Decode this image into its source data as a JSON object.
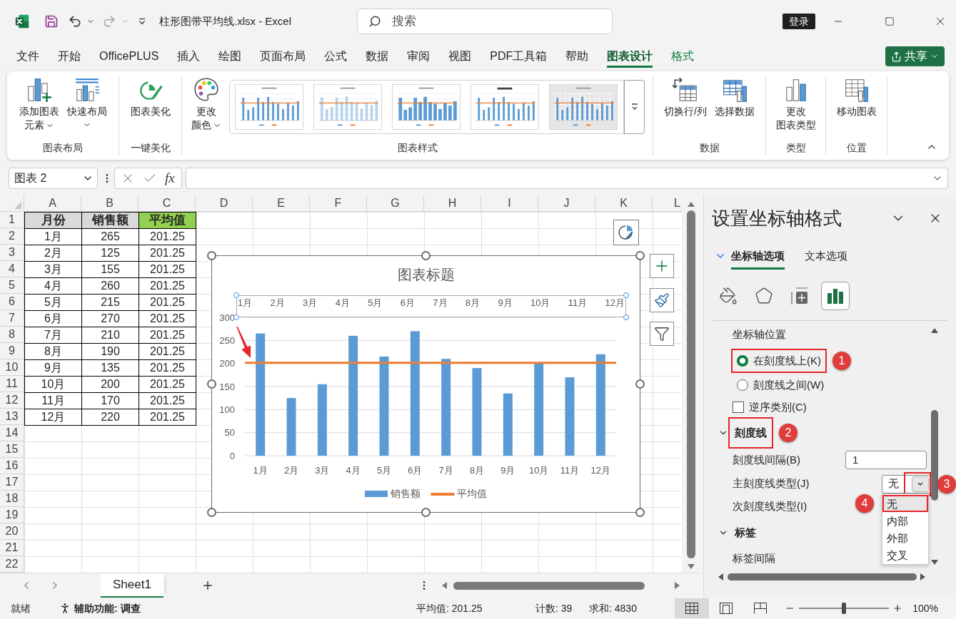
{
  "title_bar": {
    "file_title": "柱形图带平均线.xlsx - Excel",
    "search": {
      "placeholder": "搜索"
    },
    "sign_in": "登录"
  },
  "ribbon_tabs": [
    {
      "label": "文件",
      "selected": false,
      "contextual": false
    },
    {
      "label": "开始",
      "selected": false,
      "contextual": false
    },
    {
      "label": "OfficePLUS",
      "selected": false,
      "contextual": false
    },
    {
      "label": "插入",
      "selected": false,
      "contextual": false
    },
    {
      "label": "绘图",
      "selected": false,
      "contextual": false
    },
    {
      "label": "页面布局",
      "selected": false,
      "contextual": false
    },
    {
      "label": "公式",
      "selected": false,
      "contextual": false
    },
    {
      "label": "数据",
      "selected": false,
      "contextual": false
    },
    {
      "label": "审阅",
      "selected": false,
      "contextual": false
    },
    {
      "label": "视图",
      "selected": false,
      "contextual": false
    },
    {
      "label": "PDF工具箱",
      "selected": false,
      "contextual": false
    },
    {
      "label": "帮助",
      "selected": false,
      "contextual": false
    },
    {
      "label": "图表设计",
      "selected": true,
      "contextual": true
    },
    {
      "label": "格式",
      "selected": false,
      "contextual": true
    }
  ],
  "share_button": {
    "label": "共享"
  },
  "ribbon": {
    "groups": [
      {
        "label": "图表布局",
        "buttons": [
          {
            "lines": [
              "添加图表",
              "元素"
            ],
            "dropdown": true
          },
          {
            "lines": [
              "快速布局"
            ],
            "dropdown": true
          }
        ]
      },
      {
        "label": "一键美化",
        "buttons": [
          {
            "lines": [
              "图表美化"
            ],
            "dropdown": false
          }
        ]
      },
      {
        "label": "图表样式",
        "buttons": [
          {
            "lines": [
              "更改",
              "颜色"
            ],
            "dropdown": true
          }
        ],
        "gallery": [
          {
            "kind": "plain"
          },
          {
            "kind": "dotted"
          },
          {
            "kind": "wide"
          },
          {
            "kind": "bold-title"
          },
          {
            "kind": "shaded"
          }
        ]
      },
      {
        "label": "数据",
        "buttons": [
          {
            "lines": [
              "切换行/列"
            ],
            "dropdown": false
          },
          {
            "lines": [
              "选择数据"
            ],
            "dropdown": false
          }
        ]
      },
      {
        "label": "类型",
        "buttons": [
          {
            "lines": [
              "更改",
              "图表类型"
            ],
            "dropdown": false
          }
        ]
      },
      {
        "label": "位置",
        "buttons": [
          {
            "lines": [
              "移动图表"
            ],
            "dropdown": false
          }
        ]
      }
    ]
  },
  "formula_bar": {
    "name_box": "图表 2",
    "insert_function": "fx"
  },
  "sheet": {
    "columns": [
      "A",
      "B",
      "C",
      "D",
      "E",
      "F",
      "G",
      "H",
      "I",
      "J",
      "K",
      "L"
    ],
    "rows": [
      "1",
      "2",
      "3",
      "4",
      "5",
      "6",
      "7",
      "8",
      "9",
      "10",
      "11",
      "12",
      "13",
      "14",
      "15",
      "16",
      "17",
      "18",
      "19",
      "20",
      "21",
      "22"
    ],
    "table": {
      "header": [
        {
          "text": "月份",
          "color": "#d9d9d9"
        },
        {
          "text": "销售额",
          "color": "#d9d9d9"
        },
        {
          "text": "平均值",
          "color": "#92d050"
        }
      ],
      "rows": [
        [
          "1月",
          "265",
          "201.25"
        ],
        [
          "2月",
          "125",
          "201.25"
        ],
        [
          "3月",
          "155",
          "201.25"
        ],
        [
          "4月",
          "260",
          "201.25"
        ],
        [
          "5月",
          "215",
          "201.25"
        ],
        [
          "6月",
          "270",
          "201.25"
        ],
        [
          "7月",
          "210",
          "201.25"
        ],
        [
          "8月",
          "190",
          "201.25"
        ],
        [
          "9月",
          "135",
          "201.25"
        ],
        [
          "10月",
          "200",
          "201.25"
        ],
        [
          "11月",
          "170",
          "201.25"
        ],
        [
          "12月",
          "220",
          "201.25"
        ]
      ]
    },
    "chart": {
      "selected": true,
      "pointer_arrow": true,
      "top_axis": {
        "selected": true,
        "labels": [
          "1月",
          "2月",
          "3月",
          "4月",
          "5月",
          "6月",
          "7月",
          "8月",
          "9月",
          "10月",
          "11月",
          "12月"
        ]
      },
      "chart_data": {
        "type": "bar",
        "title": "图表标题",
        "categories": [
          "1月",
          "2月",
          "3月",
          "4月",
          "5月",
          "6月",
          "7月",
          "8月",
          "9月",
          "10月",
          "11月",
          "12月"
        ],
        "series": [
          {
            "name": "销售额",
            "color": "#5b9bd5",
            "values": [
              265,
              125,
              155,
              260,
              215,
              270,
              210,
              190,
              135,
              200,
              170,
              220
            ]
          }
        ],
        "ref_lines": [
          {
            "axis": "y",
            "value": 201.25,
            "label": "平均值",
            "color": "#ed7d31"
          }
        ],
        "grid": true,
        "legend": "bottom",
        "ylim": [
          0,
          300
        ],
        "yticks": [
          0,
          50,
          100,
          150,
          200,
          250,
          300
        ]
      }
    },
    "tabs": [
      {
        "label": "Sheet1",
        "selected": true
      }
    ]
  },
  "format_pane": {
    "title": "设置坐标轴格式",
    "tabs": [
      {
        "label": "坐标轴选项",
        "selected": true
      },
      {
        "label": "文本选项",
        "selected": false
      }
    ],
    "icon_tabs": [
      {
        "selected": false
      },
      {
        "selected": false
      },
      {
        "selected": false
      },
      {
        "selected": true
      }
    ],
    "items": [
      {
        "kind": "heading",
        "label": "坐标轴位置"
      },
      {
        "kind": "radio",
        "label": "在刻度线上(K)",
        "selected": true,
        "callout": "1"
      },
      {
        "kind": "radio",
        "label": "刻度线之间(W)",
        "selected": false
      },
      {
        "kind": "checkbox",
        "label": "逆序类别(C)",
        "checked": false
      },
      {
        "kind": "section",
        "label": "刻度线",
        "expanded": true,
        "callout": "2"
      },
      {
        "kind": "input",
        "label": "刻度线间隔(B)",
        "value": "1"
      },
      {
        "kind": "select",
        "label": "主刻度线类型(J)",
        "value": "无",
        "open": true,
        "callout": "3",
        "options": [
          {
            "label": "无",
            "selected": true,
            "callout": "4"
          },
          {
            "label": "内部",
            "selected": false
          },
          {
            "label": "外部",
            "selected": false
          },
          {
            "label": "交叉",
            "selected": false
          }
        ]
      },
      {
        "kind": "label",
        "label": "次刻度线类型(I)"
      },
      {
        "kind": "section",
        "label": "标签",
        "expanded": true
      },
      {
        "kind": "label",
        "label": "标签间隔"
      }
    ]
  },
  "status_bar": {
    "ready": "就绪",
    "accessibility": "辅助功能: 调查",
    "average": "平均值: 201.25",
    "count": "计数: 39",
    "sum": "求和: 4830",
    "views": [
      {
        "selected": true
      },
      {
        "selected": false
      },
      {
        "selected": false
      }
    ],
    "zoom": {
      "level": 0.5,
      "label": "100%"
    }
  }
}
